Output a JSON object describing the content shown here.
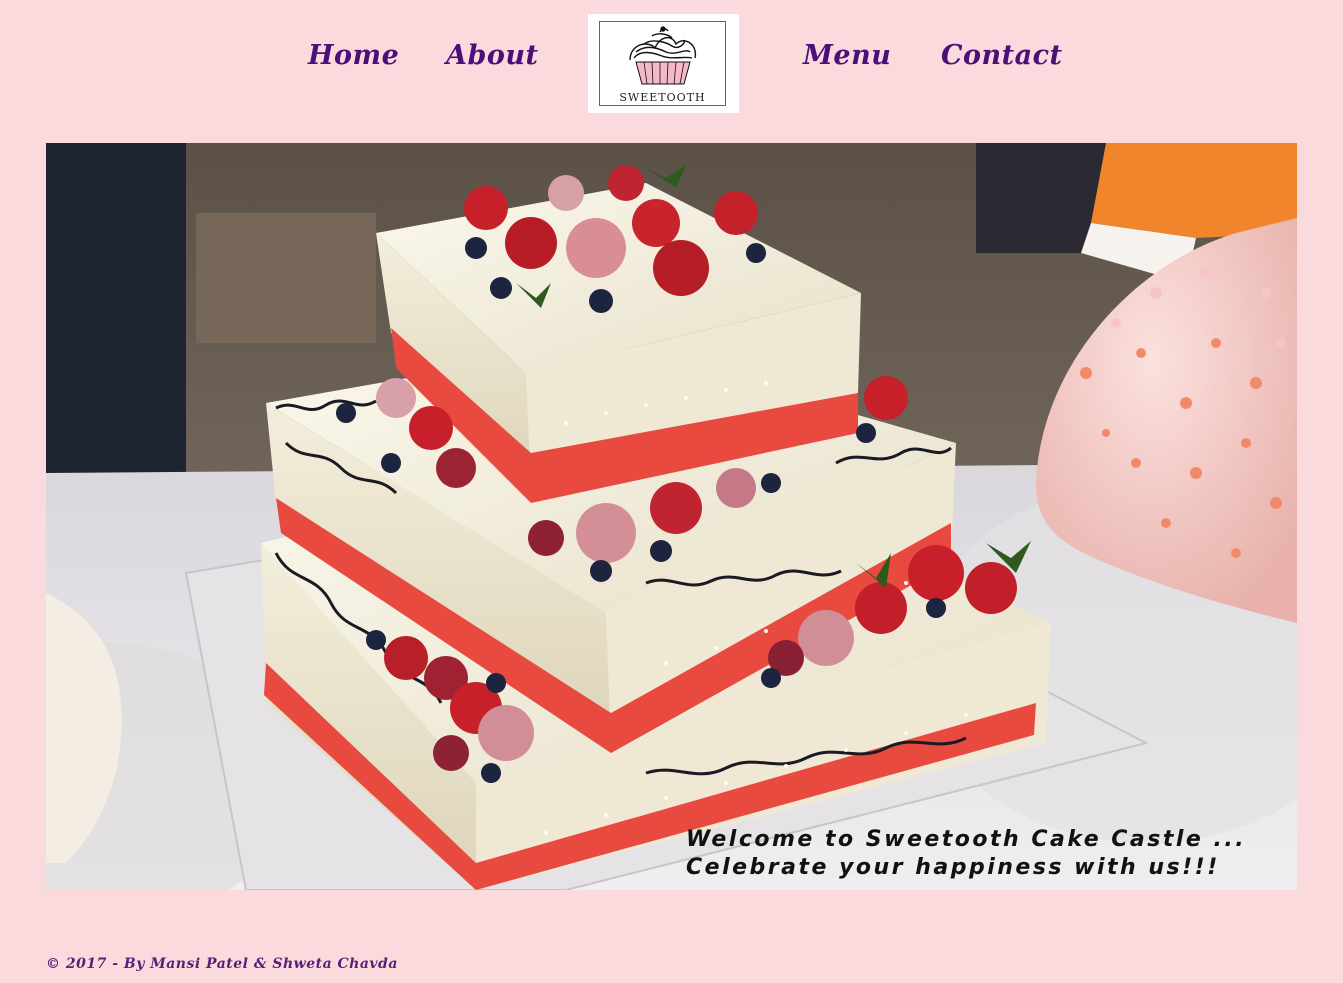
{
  "nav": {
    "home": "Home",
    "about": "About",
    "menu": "Menu",
    "contact": "Contact"
  },
  "logo": {
    "text": "SWEETOOTH",
    "icon": "cupcake-icon"
  },
  "hero": {
    "image": "tiered-cake-photo",
    "caption_line1": "Welcome to Sweetooth Cake Castle ...",
    "caption_line2": "Celebrate your happiness with us!!!"
  },
  "footer": {
    "copyright": "© 2017 - By Mansi Patel & Shweta Chavda"
  },
  "colors": {
    "background": "#fadadd",
    "nav_text": "#4b0f7a",
    "footer_text": "#5a1d78"
  }
}
